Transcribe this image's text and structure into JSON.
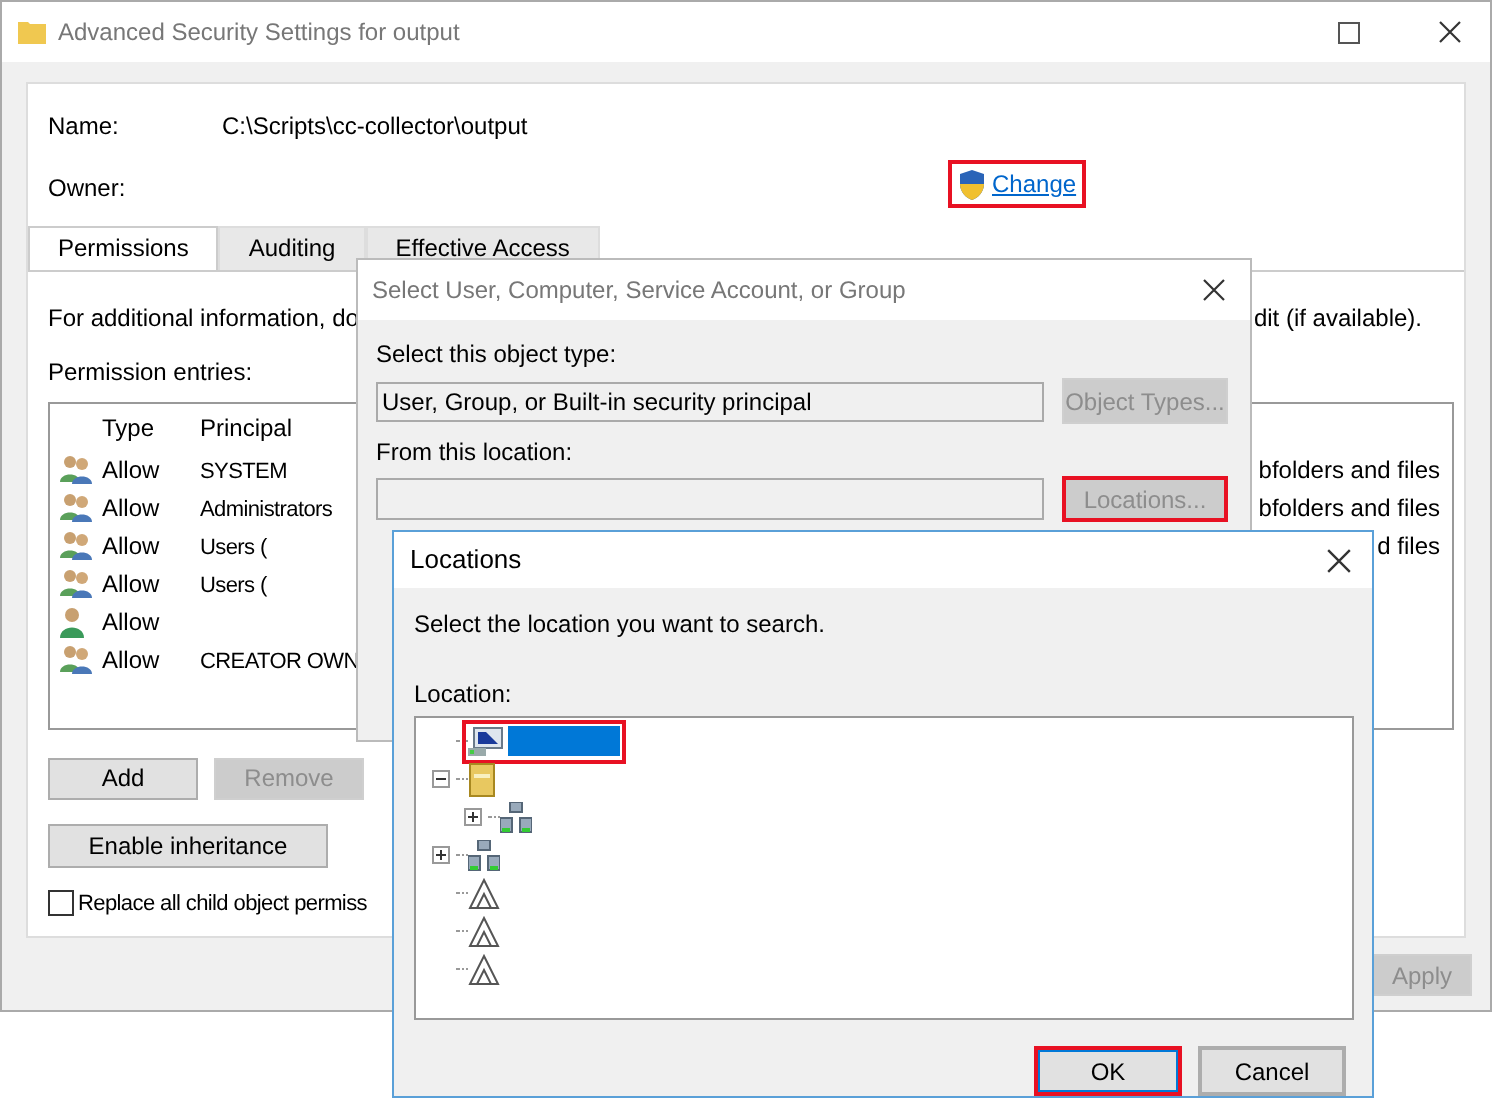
{
  "main_window": {
    "title": "Advanced Security Settings for output",
    "name_label": "Name:",
    "name_value": "C:\\Scripts\\cc-collector\\output",
    "owner_label": "Owner:",
    "change_link": {
      "label": "Change",
      "highlighted": true
    },
    "tabs": [
      {
        "label": "Permissions",
        "selected": true
      },
      {
        "label": "Auditing",
        "selected": false
      },
      {
        "label": "Effective Access",
        "selected": false
      }
    ],
    "info_text": "For additional information, do",
    "info_text_end": "dit (if available).",
    "entries_label": "Permission entries:",
    "columns": [
      "Type",
      "Principal"
    ],
    "rows": [
      {
        "kind": "group",
        "type": "Allow",
        "principal": "SYSTEM",
        "applies_to": "bfolders and files"
      },
      {
        "kind": "group",
        "type": "Allow",
        "principal": "Administrators",
        "applies_to": "bfolders and files"
      },
      {
        "kind": "group",
        "type": "Allow",
        "principal": "Users (",
        "applies_to": "d files"
      },
      {
        "kind": "group",
        "type": "Allow",
        "principal": "Users ("
      },
      {
        "kind": "user",
        "type": "Allow"
      },
      {
        "kind": "group",
        "type": "Allow",
        "principal": "CREATOR OWN"
      }
    ],
    "buttons": [
      {
        "label": "Add",
        "disabled": false
      },
      {
        "label": "Remove",
        "disabled": true
      }
    ],
    "inheritance_button": "Enable inheritance",
    "replace_checkbox": {
      "label": "Replace all child object permiss",
      "checked": false
    },
    "apply_button": {
      "label": "Apply",
      "disabled": true
    }
  },
  "select_dialog": {
    "title": "Select User, Computer, Service Account, or Group",
    "object_type_label": "Select this object type:",
    "object_type_value": "User, Group, or Built-in security principal",
    "object_types_button": {
      "label": "Object Types...",
      "disabled": true,
      "highlighted": false
    },
    "location_label": "From this location:",
    "locations_button": {
      "label": "Locations...",
      "disabled": true,
      "highlighted": true
    }
  },
  "locations_dialog": {
    "title": "Locations",
    "instruction": "Select the location you want to search.",
    "location_label": "Location:",
    "tree": [
      {
        "kind": "computer",
        "selected": true,
        "highlighted": true
      },
      {
        "kind": "domain",
        "selected": false,
        "expanded": true,
        "children": [
          {
            "kind": "directory",
            "selected": false,
            "expanded": false
          }
        ]
      },
      {
        "kind": "directory",
        "selected": false,
        "expanded": false
      },
      {
        "kind": "trust",
        "selected": false
      },
      {
        "kind": "trust",
        "selected": false
      },
      {
        "kind": "trust",
        "selected": false
      }
    ],
    "buttons": [
      {
        "label": "OK",
        "default": true,
        "highlighted": true
      },
      {
        "label": "Cancel",
        "default": false,
        "highlighted": false
      }
    ]
  }
}
